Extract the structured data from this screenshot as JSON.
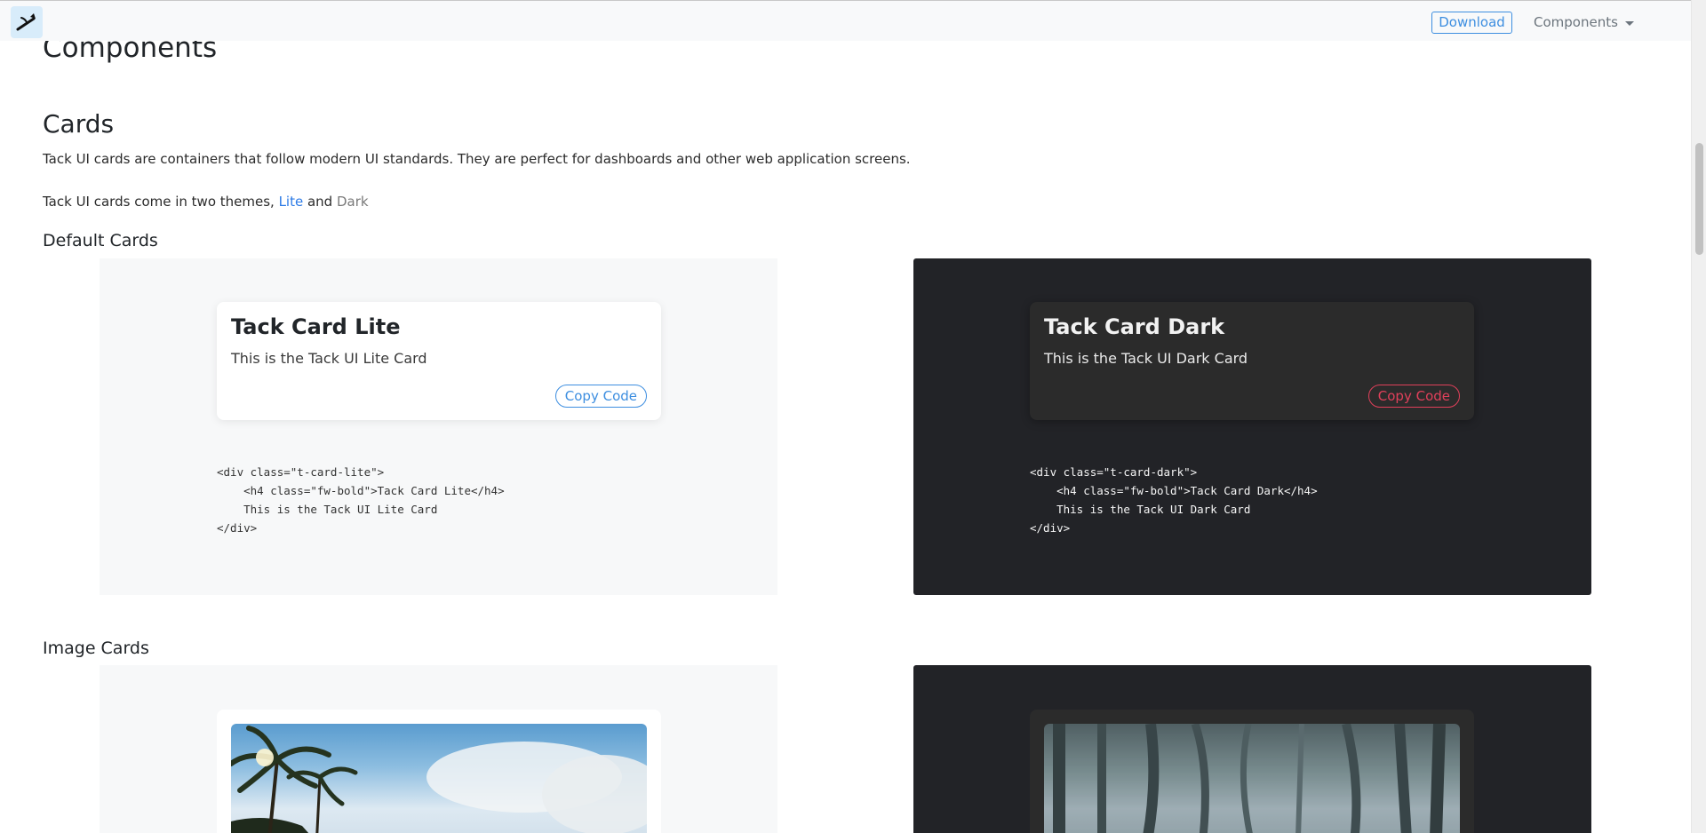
{
  "navbar": {
    "download_label": "Download",
    "components_label": "Components"
  },
  "page": {
    "title": "Components",
    "section_title": "Cards",
    "intro": "Tack UI cards are containers that follow modern UI standards. They are perfect for dashboards and other web application screens.",
    "themes_prefix": "Tack UI cards come in two themes, ",
    "themes_lite": "Lite",
    "themes_and": " and ",
    "themes_dark": "Dark"
  },
  "default_cards": {
    "heading": "Default Cards",
    "lite": {
      "title": "Tack Card Lite",
      "text": "This is the Tack UI Lite Card",
      "copy_label": "Copy Code",
      "code": "<div class=\"t-card-lite\">\n    <h4 class=\"fw-bold\">Tack Card Lite</h4>\n    This is the Tack UI Lite Card\n</div>"
    },
    "dark": {
      "title": "Tack Card Dark",
      "text": "This is the Tack UI Dark Card",
      "copy_label": "Copy Code",
      "code": "<div class=\"t-card-dark\">\n    <h4 class=\"fw-bold\">Tack Card Dark</h4>\n    This is the Tack UI Dark Card\n</div>"
    }
  },
  "image_cards": {
    "heading": "Image Cards"
  },
  "colors": {
    "accent_blue": "#3d8ee0",
    "accent_red": "#e0405a",
    "dark_panel": "#222327",
    "lite_panel": "#f7f8f9"
  }
}
